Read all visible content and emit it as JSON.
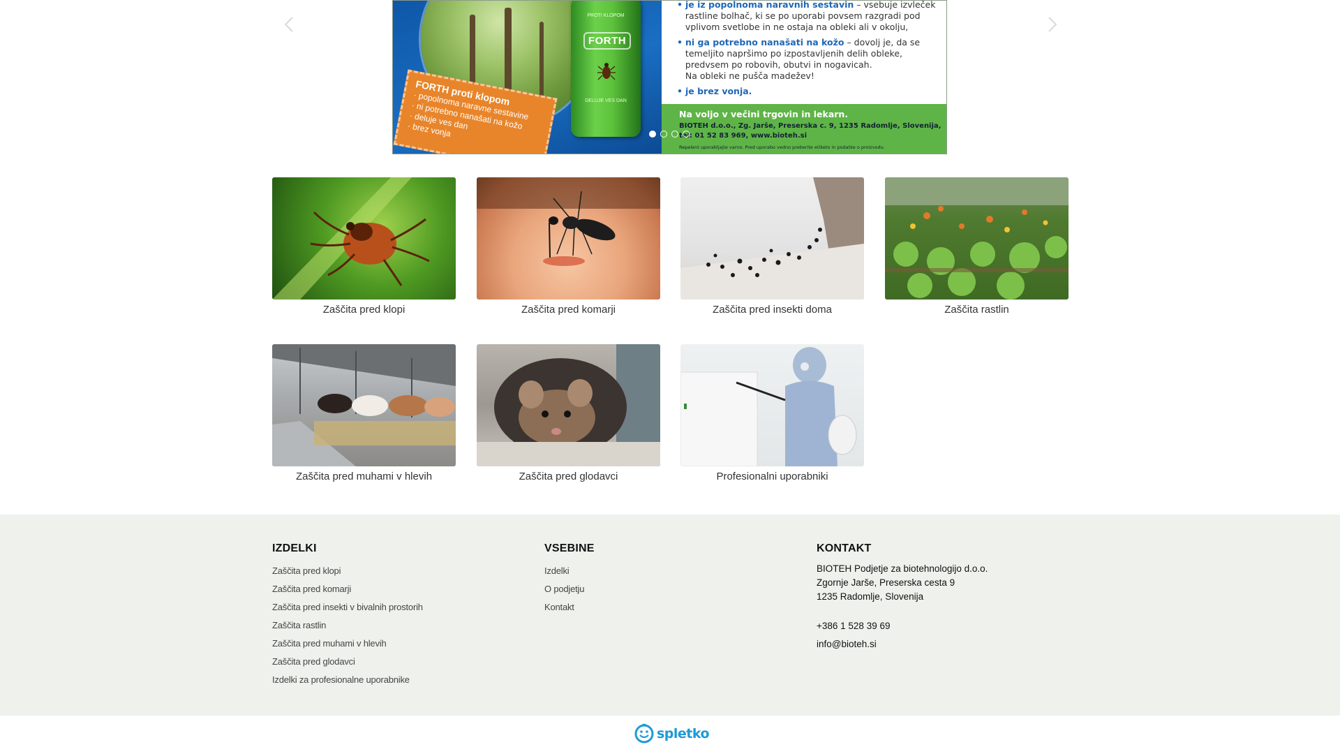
{
  "slider": {
    "sticker": {
      "title": "FORTH proti klopom",
      "lines": [
        "· popolnoma naravne sestavine",
        "· ni potrebno nanašati na kožo",
        "· deluje ves dan",
        "· brez vonja"
      ]
    },
    "can": {
      "brand": "FORTH",
      "top_text": "PROTI KLOPOM",
      "bottom_text": "DELUJE VES DAN"
    },
    "features": {
      "f1_highlight": "je iz popolnoma naravnih sestavin",
      "f1_rest1": " – vsebuje izvleček",
      "f1_rest2": "rastline bolhač, ki se po uporabi povsem razgradi pod",
      "f1_rest3": "vplivom svetlobe in ne ostaja na obleki ali v okolju,",
      "f2_highlight": "ni ga potrebno nanašati na kožo",
      "f2_rest1": " – dovolj je, da se",
      "f2_rest2": "temeljito napršimo po izpostavljenih delih obleke,",
      "f2_rest3": "predvsem po robovih, obutvi in nogavicah.",
      "f2_rest4": "Na obleki ne pušča madežev!",
      "f3_highlight": "je brez vonja."
    },
    "availability": "Na voljo v večini trgovin in lekarn.",
    "address_line": "BIOTEH d.o.o., Zg. Jarše, Preserska c. 9, 1235 Radomlje, Slovenija,",
    "phone_line": "tel: 01 52 83 969, www.bioteh.si",
    "disclaimer": "Repelent uporabljajte varno. Pred uporabo vedno preberite etiketo in podatke o proizvodu.",
    "dots_count": 4,
    "active_dot": 0
  },
  "categories": [
    {
      "label": "Zaščita pred klopi",
      "image": "tick-on-leaf"
    },
    {
      "label": "Zaščita pred komarji",
      "image": "mosquito-on-skin"
    },
    {
      "label": "Zaščita pred insekti doma",
      "image": "ants-in-corner"
    },
    {
      "label": "Zaščita rastlin",
      "image": "garden-beds"
    },
    {
      "label": "Zaščita pred muhami v hlevih",
      "image": "cows-in-barn"
    },
    {
      "label": "Zaščita pred glodavci",
      "image": "rat-in-hole"
    },
    {
      "label": "Profesionalni uporabniki",
      "image": "pest-control-worker"
    }
  ],
  "footer": {
    "izdelki": {
      "title": "IZDELKI",
      "links": [
        "Zaščita pred klopi",
        "Zaščita pred komarji",
        "Zaščita pred insekti v bivalnih prostorih",
        "Zaščita rastlin",
        "Zaščita pred muhami v hlevih",
        "Zaščita pred glodavci",
        "Izdelki za profesionalne uporabnike"
      ]
    },
    "vsebine": {
      "title": "VSEBINE",
      "links": [
        "Izdelki",
        "O podjetju",
        "Kontakt"
      ]
    },
    "kontakt": {
      "title": "KONTAKT",
      "company": "BIOTEH Podjetje za biotehnologijo d.o.o.",
      "street": "Zgornje Jarše, Preserska cesta 9",
      "city": "1235 Radomlje, Slovenija",
      "phone": "+386 1 528 39 69",
      "email": "info@bioteh.si"
    }
  },
  "credit": {
    "logo_text": "spletko",
    "accent": "#1d9ad6"
  },
  "colors": {
    "footer_bg": "#eff2ec",
    "banner_green": "#5fb447",
    "banner_blue": "#1f67b6",
    "sticker_orange": "#e8852a"
  }
}
